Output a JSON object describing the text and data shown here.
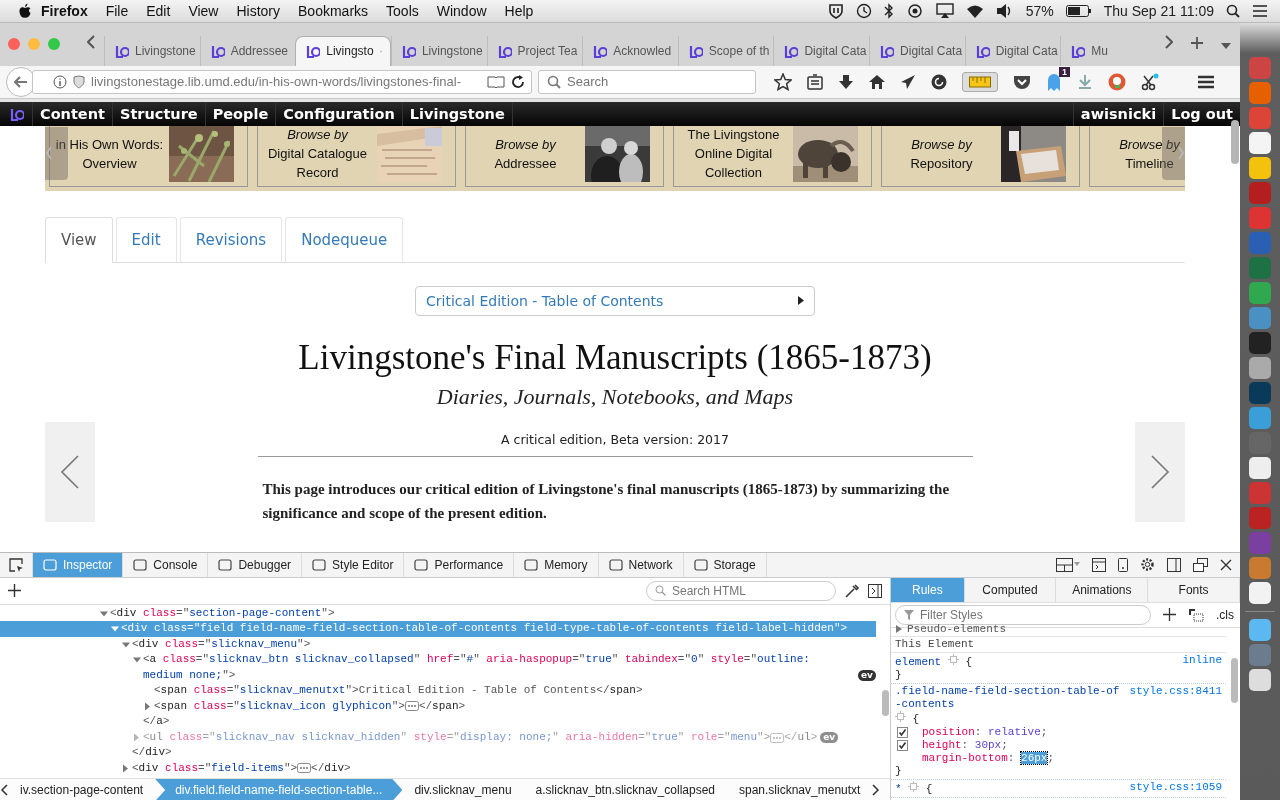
{
  "menubar": {
    "app": "Firefox",
    "menus": [
      "File",
      "Edit",
      "View",
      "History",
      "Bookmarks",
      "Tools",
      "Window",
      "Help"
    ],
    "battery": "57%",
    "clock": "Thu Sep 21 11:09"
  },
  "browser": {
    "tabs": [
      {
        "title": "Livingstone",
        "selected": false
      },
      {
        "title": "Addressee",
        "selected": false
      },
      {
        "title": "Livingsto",
        "selected": true
      },
      {
        "title": "Livingstone",
        "selected": false
      },
      {
        "title": "Project Tea",
        "selected": false
      },
      {
        "title": "Acknowled",
        "selected": false
      },
      {
        "title": "Scope of th",
        "selected": false
      },
      {
        "title": "Digital Cata",
        "selected": false
      },
      {
        "title": "Digital Cata",
        "selected": false
      },
      {
        "title": "Digital Cata",
        "selected": false
      },
      {
        "title": "Mu",
        "selected": false
      }
    ],
    "url_host": "livingstonestage.lib.umd.edu",
    "url_path": "/in-his-own-words/livingstones-final-",
    "search": {
      "placeholder": "Search"
    },
    "notification_badge": "1"
  },
  "admin_bar": {
    "items": [
      "Content",
      "Structure",
      "People",
      "Configuration",
      "Livingstone"
    ],
    "user_items": [
      "awisnicki",
      "Log out"
    ]
  },
  "carousel": [
    {
      "lines": [
        {
          "text": "in His Own Words:",
          "italic": false
        },
        {
          "text": "Overview",
          "italic": false
        }
      ],
      "picture": true
    },
    {
      "lines": [
        {
          "text": "Browse by",
          "italic": true
        },
        {
          "text": "Digital Catalogue",
          "italic": false
        },
        {
          "text": "Record",
          "italic": false
        }
      ],
      "picture": true
    },
    {
      "lines": [
        {
          "text": "Browse by",
          "italic": true
        },
        {
          "text": "Addressee",
          "italic": false
        }
      ],
      "picture": true
    },
    {
      "lines": [
        {
          "text": "The Livingstone",
          "italic": false
        },
        {
          "text": "Online Digital",
          "italic": false
        },
        {
          "text": "Collection",
          "italic": false
        }
      ],
      "picture": true
    },
    {
      "lines": [
        {
          "text": "Browse by",
          "italic": true
        },
        {
          "text": "Repository",
          "italic": false
        }
      ],
      "picture": true
    },
    {
      "lines": [
        {
          "text": "Browse by",
          "italic": true
        },
        {
          "text": "Timeline",
          "italic": false
        }
      ],
      "picture": false
    }
  ],
  "page_tabs": [
    {
      "label": "View",
      "selected": true
    },
    {
      "label": "Edit",
      "selected": false
    },
    {
      "label": "Revisions",
      "selected": false
    },
    {
      "label": "Nodequeue",
      "selected": false
    }
  ],
  "toc_dropdown": "Critical Edition - Table of Contents",
  "title": "Livingstone's Final Manuscripts (1865-1873)",
  "subtitle": "Diaries, Journals, Notebooks, and Maps",
  "edition_note": "A critical edition, Beta version: 2017",
  "intro": "This page introduces our critical edition of Livingstone's final manuscripts (1865-1873) by summarizing the significance and scope of the present edition.",
  "devtools": {
    "tools": [
      {
        "label": "Inspector",
        "selected": true
      },
      {
        "label": "Console",
        "selected": false
      },
      {
        "label": "Debugger",
        "selected": false
      },
      {
        "label": "Style Editor",
        "selected": false
      },
      {
        "label": "Performance",
        "selected": false
      },
      {
        "label": "Memory",
        "selected": false
      },
      {
        "label": "Network",
        "selected": false
      },
      {
        "label": "Storage",
        "selected": false
      }
    ],
    "search": {
      "placeholder": "Search HTML"
    },
    "markup": [
      {
        "kind": "open",
        "selected": false,
        "hidden": false,
        "text": "<div class=\"section-page-content\">",
        "children": [
          {
            "kind": "open",
            "selected": true,
            "hidden": false,
            "text": "<div class=\"field field-name-field-section-table-of-contents field-type-table-of-contents field-label-hidden\">",
            "children": [
              {
                "kind": "open",
                "selected": false,
                "hidden": false,
                "text": "<div class=\"slicknav_menu\">",
                "children": [
                  {
                    "kind": "open",
                    "selected": false,
                    "hidden": false,
                    "text": "<a class=\"slicknav_btn slicknav_collapsed\" href=\"#\" aria-haspopup=\"true\" tabindex=\"0\" style=\"outline: medium none;\">",
                    "badge": "ev",
                    "children": [
                      {
                        "kind": "leaf",
                        "selected": false,
                        "hidden": false,
                        "text": "<span class=\"slicknav_menutxt\">Critical Edition - Table of Contents</span>"
                      },
                      {
                        "kind": "collapsed",
                        "selected": false,
                        "hidden": false,
                        "text": "<span class=\"slicknav_icon glyphicon\">",
                        "after": "</span>"
                      }
                    ],
                    "close": "</a>"
                  },
                  {
                    "kind": "collapsed",
                    "selected": false,
                    "hidden": true,
                    "text": "<ul class=\"slicknav_nav slicknav_hidden\" style=\"display: none;\" aria-hidden=\"true\" role=\"menu\">",
                    "after": "</ul>",
                    "badge": "ev"
                  }
                ],
                "close": "</div>"
              },
              {
                "kind": "collapsed",
                "selected": false,
                "hidden": false,
                "text": "<div class=\"field-items\">",
                "after": "</div>"
              }
            ]
          }
        ]
      }
    ],
    "breadcrumbs": [
      {
        "label": "iv.section-page-content",
        "selected": false
      },
      {
        "label": "div.field.field-name-field-section-table...",
        "selected": true
      },
      {
        "label": "div.slicknav_menu",
        "selected": false
      },
      {
        "label": "a.slicknav_btn.slicknav_collapsed",
        "selected": false
      },
      {
        "label": "span.slicknav_menutxt",
        "selected": false
      }
    ],
    "sidebar_tabs": [
      {
        "label": "Rules",
        "selected": true
      },
      {
        "label": "Computed",
        "selected": false
      },
      {
        "label": "Animations",
        "selected": false
      },
      {
        "label": "Fonts",
        "selected": false
      }
    ],
    "filter": {
      "placeholder": "Filter Styles"
    },
    "cls_button": ".cls",
    "pseudo_elements": "Pseudo-elements",
    "this_element": "This Element",
    "rules": [
      {
        "selector": "element",
        "open_brace": "{",
        "source": "inline",
        "close_brace": "}"
      },
      {
        "selector": ".field-name-field-section-table-of-contents",
        "open_brace": "{",
        "source": "style.css:8411",
        "declarations": [
          {
            "kind": "toggle",
            "checked": true,
            "text": "position: relative;"
          },
          {
            "kind": "toggle",
            "checked": true,
            "text": "height: 30px;"
          },
          {
            "kind": "edit",
            "checked": false,
            "text": "margin-bottom: 26px;"
          }
        ],
        "close_brace": "}"
      },
      {
        "selector": "*",
        "open_brace": "{",
        "source": "style.css:1059"
      }
    ]
  }
}
